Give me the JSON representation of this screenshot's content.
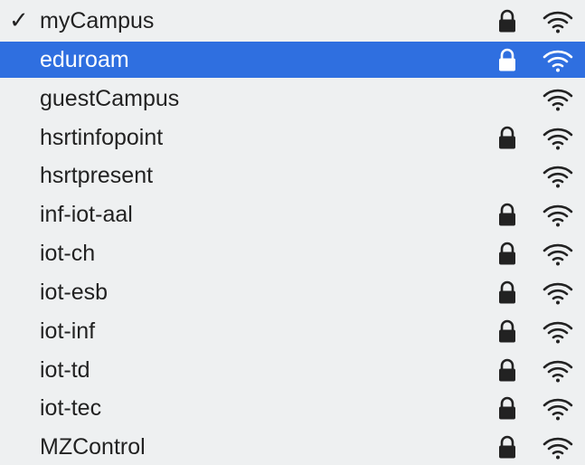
{
  "networks": [
    {
      "name": "myCampus",
      "connected": true,
      "selected": false,
      "secured": true,
      "check_glyph": "✓",
      "wifi_icon": "wifi-icon",
      "lock_icon": "lock-icon"
    },
    {
      "name": "eduroam",
      "connected": false,
      "selected": true,
      "secured": true,
      "wifi_icon": "wifi-icon",
      "lock_icon": "lock-icon"
    },
    {
      "name": "guestCampus",
      "connected": false,
      "selected": false,
      "secured": false,
      "wifi_icon": "wifi-icon"
    },
    {
      "name": "hsrtinfopoint",
      "connected": false,
      "selected": false,
      "secured": true,
      "wifi_icon": "wifi-icon",
      "lock_icon": "lock-icon"
    },
    {
      "name": "hsrtpresent",
      "connected": false,
      "selected": false,
      "secured": false,
      "wifi_icon": "wifi-icon"
    },
    {
      "name": "inf-iot-aal",
      "connected": false,
      "selected": false,
      "secured": true,
      "wifi_icon": "wifi-icon",
      "lock_icon": "lock-icon"
    },
    {
      "name": "iot-ch",
      "connected": false,
      "selected": false,
      "secured": true,
      "wifi_icon": "wifi-icon",
      "lock_icon": "lock-icon"
    },
    {
      "name": "iot-esb",
      "connected": false,
      "selected": false,
      "secured": true,
      "wifi_icon": "wifi-icon",
      "lock_icon": "lock-icon"
    },
    {
      "name": "iot-inf",
      "connected": false,
      "selected": false,
      "secured": true,
      "wifi_icon": "wifi-icon",
      "lock_icon": "lock-icon"
    },
    {
      "name": "iot-td",
      "connected": false,
      "selected": false,
      "secured": true,
      "wifi_icon": "wifi-icon",
      "lock_icon": "lock-icon"
    },
    {
      "name": "iot-tec",
      "connected": false,
      "selected": false,
      "secured": true,
      "wifi_icon": "wifi-icon",
      "lock_icon": "lock-icon"
    },
    {
      "name": "MZControl",
      "connected": false,
      "selected": false,
      "secured": true,
      "wifi_icon": "wifi-icon",
      "lock_icon": "lock-icon"
    }
  ],
  "colors": {
    "background": "#eef0f1",
    "selected_background": "#2f6fe0",
    "text": "#222222",
    "selected_text": "#ffffff"
  }
}
